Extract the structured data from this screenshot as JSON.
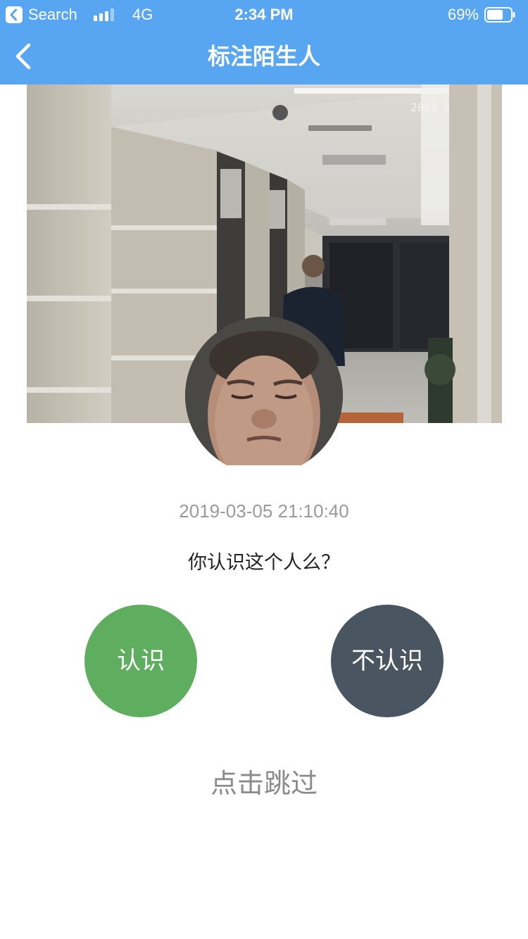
{
  "status_bar": {
    "back_app_label": "Search",
    "network": "4G",
    "time": "2:34 PM",
    "battery_percent": "69%",
    "battery_level": 0.69,
    "signal_bars_active": 3
  },
  "nav": {
    "title": "标注陌生人"
  },
  "snapshot": {
    "overlay_text": "2009-04-22",
    "icon": "camera-snapshot-image"
  },
  "face": {
    "icon": "face-crop-avatar"
  },
  "capture_time": "2019-03-05 21:10:40",
  "question": "你认识这个人么？",
  "buttons": {
    "know": "认识",
    "unknown": "不认识"
  },
  "skip": "点击跳过",
  "colors": {
    "header": "#58a6f2",
    "know": "#5fae5f",
    "unknown": "#495560",
    "timestamp": "#9a9a9a",
    "skip": "#8a8a8a"
  }
}
